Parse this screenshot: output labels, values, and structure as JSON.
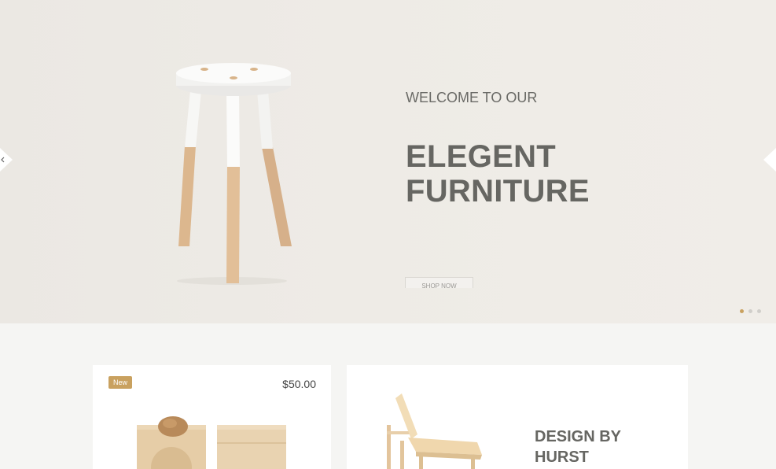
{
  "hero": {
    "subtitle": "WELCOME TO OUR",
    "title_line1": "ELEGENT",
    "title_line2": "FURNITURE",
    "shop_button": "SHOP NOW",
    "prev_icon": "chevron-left-icon",
    "next_icon": "chevron-right-icon",
    "slides_count": 3,
    "active_slide": 1
  },
  "product": {
    "badge": "New",
    "price": "$50.00"
  },
  "feature": {
    "title_line1": "DESIGN BY",
    "title_line2": "HURST"
  },
  "colors": {
    "accent": "#c9a15f",
    "heading": "#666662",
    "hero_bg": "#eeebe6",
    "page_bg": "#f5f5f3"
  }
}
